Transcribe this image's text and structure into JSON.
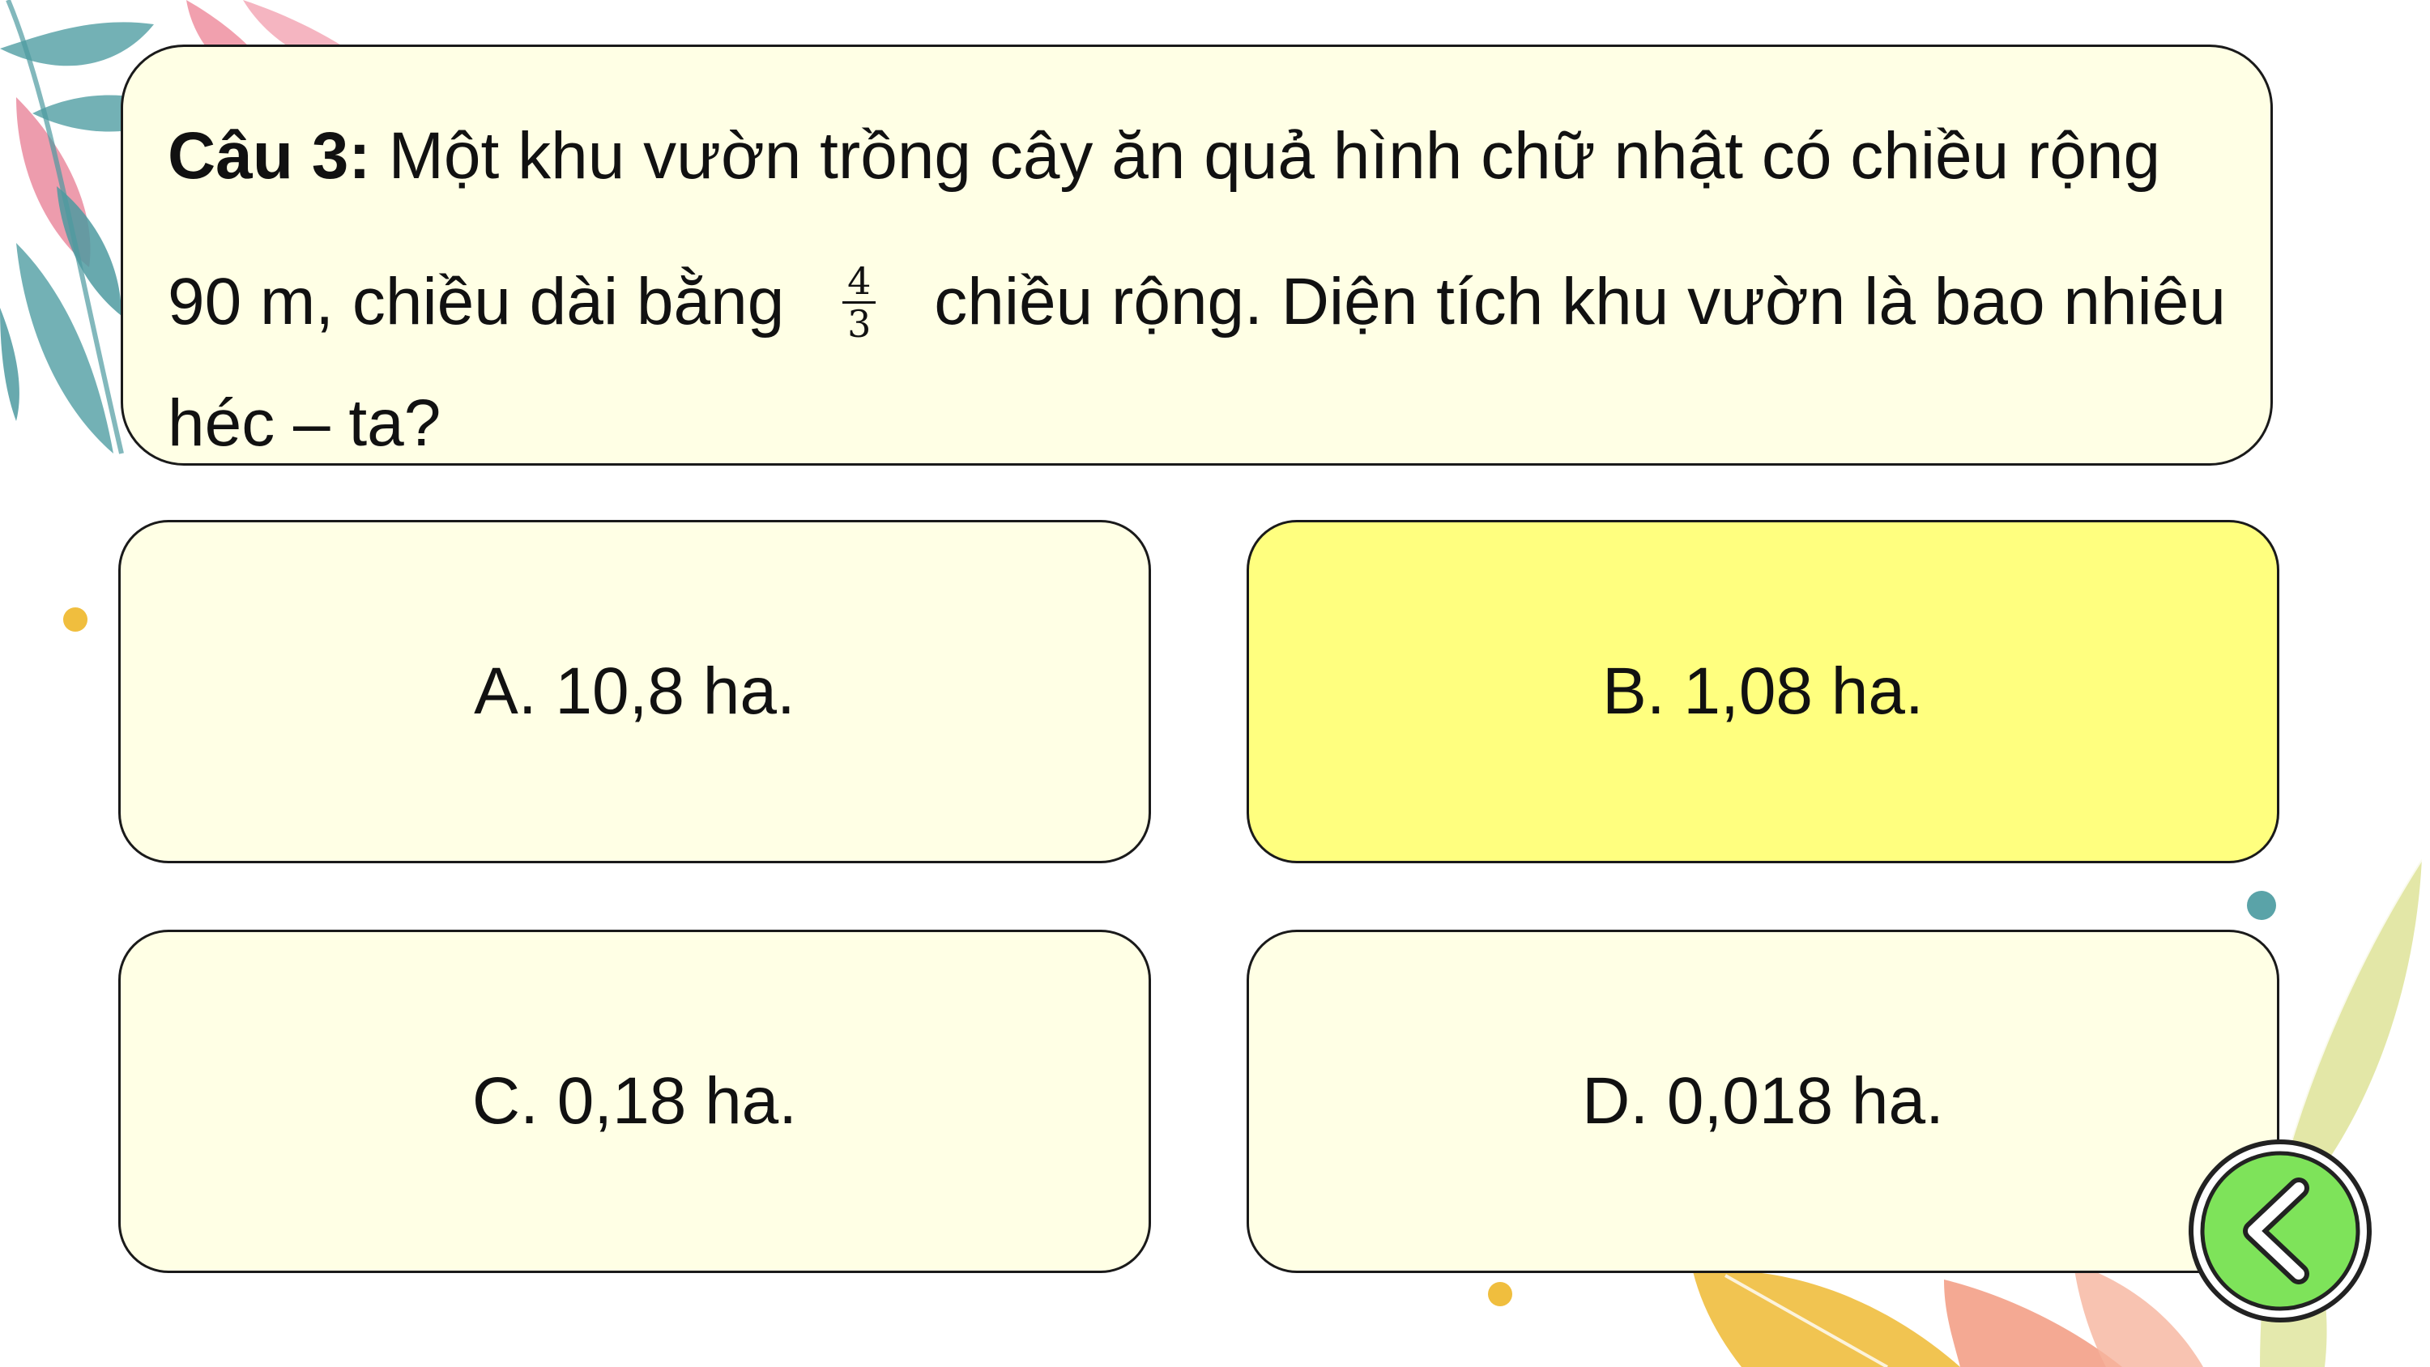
{
  "question": {
    "label": "Câu 3:",
    "line1_rest": "Một khu vườn trồng cây ăn quả hình chữ nhật có chiều rộng",
    "line2_before": "90 m, chiều dài bằng",
    "fraction_numerator": "4",
    "fraction_denominator": "3",
    "line2_after": "chiều rộng. Diện tích khu vườn là bao nhiêu",
    "line3": "héc – ta?"
  },
  "answers": {
    "a": "A. 10,8 ha.",
    "b": "B. 1,08 ha.",
    "c": "C. 0,18 ha.",
    "d": "D. 0,018 ha."
  },
  "selected_answer": "b",
  "back_button": {
    "icon": "chevron-left-icon"
  },
  "colors": {
    "card_fill": "#ffffe5",
    "selected_fill": "#ffff7f",
    "back_button_fill": "#7ee35a"
  }
}
